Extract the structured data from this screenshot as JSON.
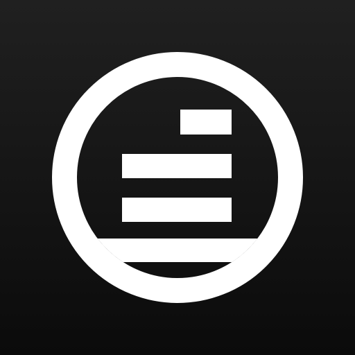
{
  "app_icon": {
    "icon_name": "circle-with-horizontal-bars-logo-icon",
    "colors": {
      "background_top": "#202020",
      "background_bottom": "#0b0b0b",
      "mark": "#ffffff"
    }
  }
}
